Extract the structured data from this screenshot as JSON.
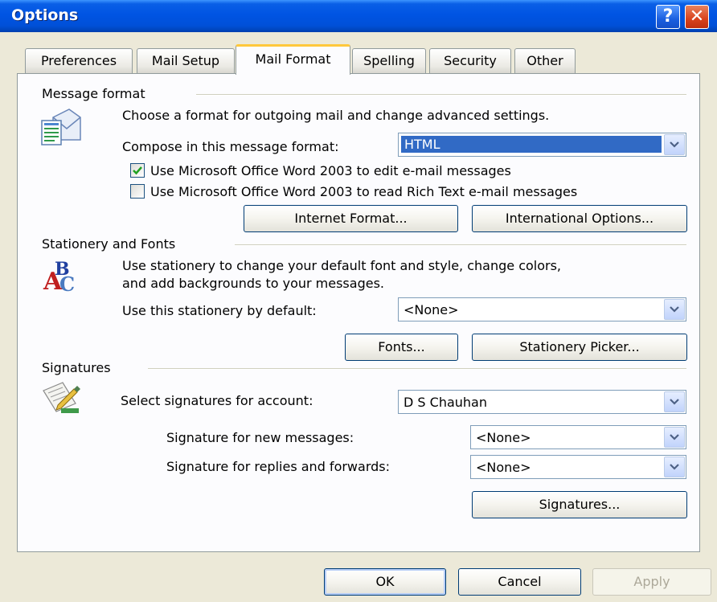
{
  "window": {
    "title": "Options"
  },
  "tabs": [
    {
      "label": "Preferences"
    },
    {
      "label": "Mail Setup"
    },
    {
      "label": "Mail Format",
      "active": true
    },
    {
      "label": "Spelling"
    },
    {
      "label": "Security"
    },
    {
      "label": "Other"
    }
  ],
  "message_format": {
    "title": "Message format",
    "description": "Choose a format for outgoing mail and change advanced settings.",
    "compose_label": "Compose in this message format:",
    "compose_value": "HTML",
    "word_edit": {
      "label": "Use Microsoft Office Word 2003 to edit e-mail messages",
      "checked": true
    },
    "word_read": {
      "label": "Use Microsoft Office Word 2003 to read Rich Text e-mail messages",
      "checked": false
    },
    "internet_format_button": "Internet Format...",
    "international_options_button": "International Options..."
  },
  "stationery": {
    "title": "Stationery and Fonts",
    "description_line1": "Use stationery to change your default font and style, change colors,",
    "description_line2": "and add backgrounds to your messages.",
    "default_label": "Use this stationery by default:",
    "default_value": "<None>",
    "fonts_button": "Fonts...",
    "stationery_picker_button": "Stationery Picker..."
  },
  "signatures": {
    "title": "Signatures",
    "account_label": "Select signatures for account:",
    "account_value": "D S Chauhan",
    "new_messages_label": "Signature for new messages:",
    "new_messages_value": "<None>",
    "replies_label": "Signature for replies and forwards:",
    "replies_value": "<None>",
    "signatures_button": "Signatures..."
  },
  "footer": {
    "ok": "OK",
    "cancel": "Cancel",
    "apply": "Apply"
  },
  "icons": {
    "help": "help-icon",
    "close": "close-icon",
    "message_format": "envelope-document-icon",
    "stationery": "abc-fonts-icon",
    "signatures": "pen-paper-icon"
  },
  "colors": {
    "titlebar": "#0054e3",
    "dialog_bg": "#ece9d8",
    "selection": "#316ac5",
    "active_tab_accent": "#ffc83c"
  }
}
